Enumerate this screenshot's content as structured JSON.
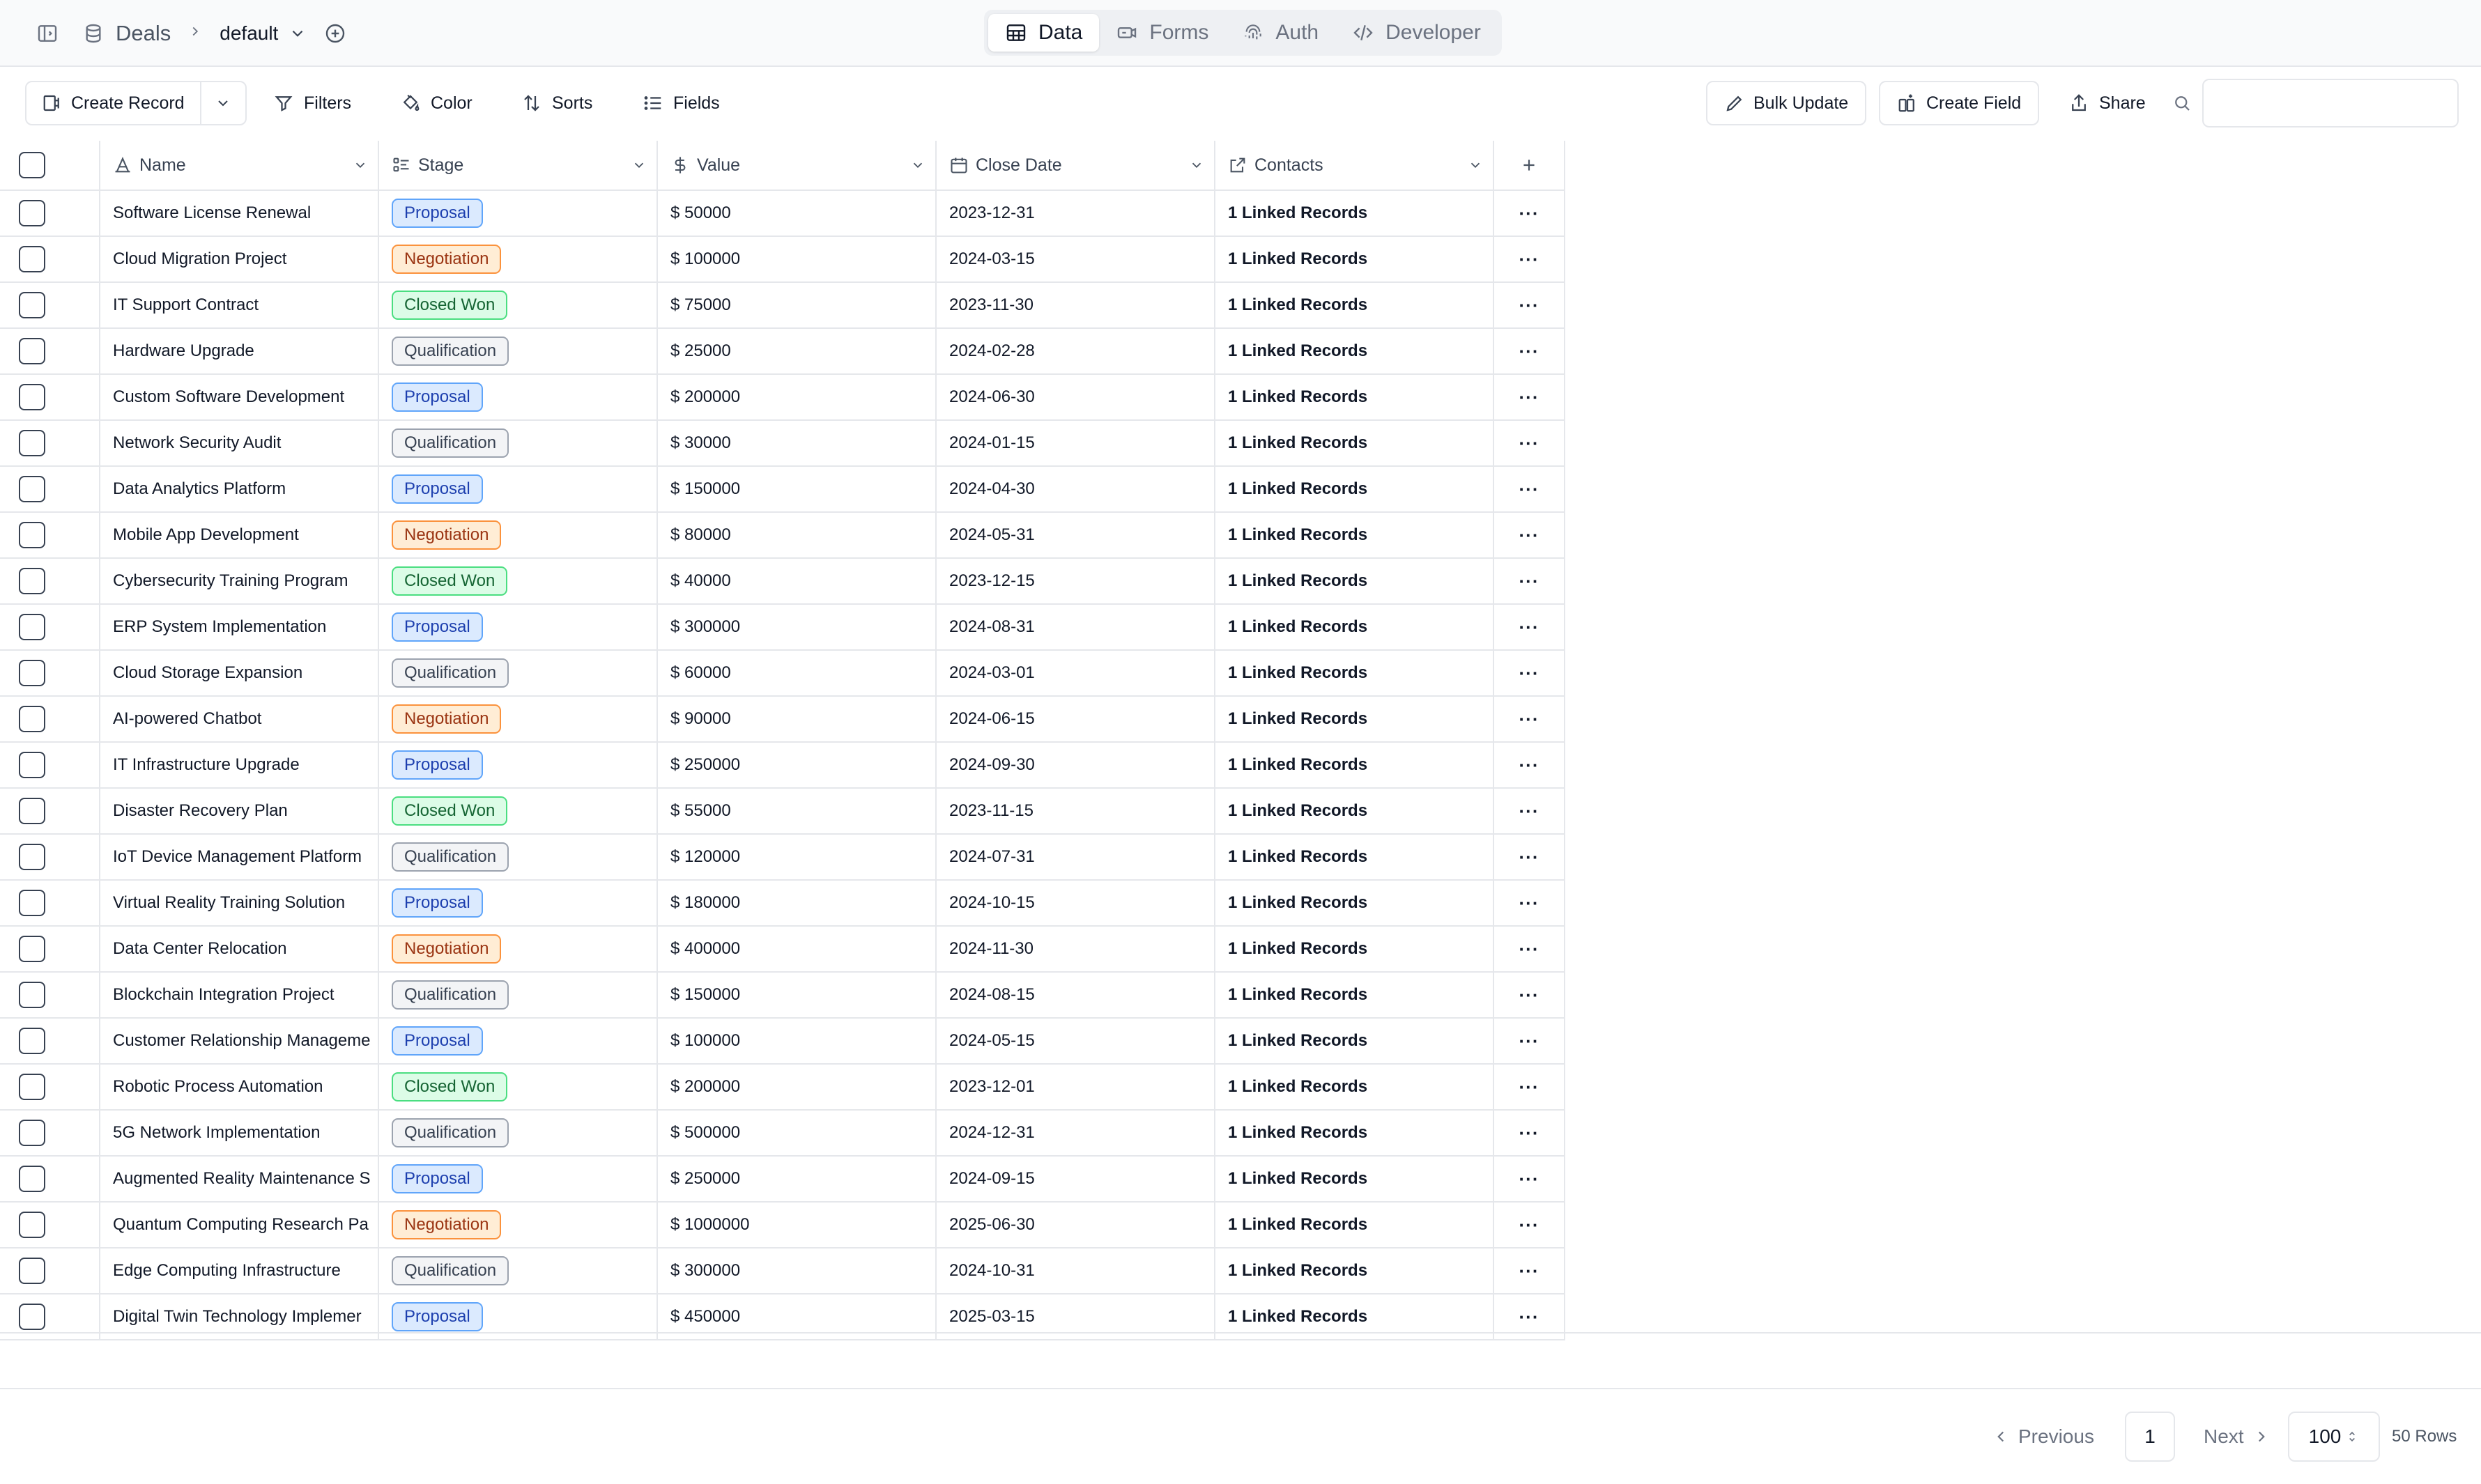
{
  "header": {
    "breadcrumb": {
      "table": "Deals",
      "view": "default"
    },
    "tabs": [
      {
        "label": "Data",
        "icon": "table-icon",
        "active": true
      },
      {
        "label": "Forms",
        "icon": "forms-icon",
        "active": false
      },
      {
        "label": "Auth",
        "icon": "fingerprint-icon",
        "active": false
      },
      {
        "label": "Developer",
        "icon": "code-icon",
        "active": false
      }
    ]
  },
  "toolbar": {
    "create_record": "Create Record",
    "filters": "Filters",
    "color": "Color",
    "sorts": "Sorts",
    "fields": "Fields",
    "bulk_update": "Bulk Update",
    "create_field": "Create Field",
    "share": "Share",
    "search_placeholder": ""
  },
  "table": {
    "columns": {
      "name": "Name",
      "stage": "Stage",
      "value": "Value",
      "close_date": "Close Date",
      "contacts": "Contacts"
    },
    "rows": [
      {
        "name": "Software License Renewal",
        "stage": "Proposal",
        "value": "$ 50000",
        "close_date": "2023-12-31",
        "contacts": "1 Linked Records"
      },
      {
        "name": "Cloud Migration Project",
        "stage": "Negotiation",
        "value": "$ 100000",
        "close_date": "2024-03-15",
        "contacts": "1 Linked Records"
      },
      {
        "name": "IT Support Contract",
        "stage": "Closed Won",
        "value": "$ 75000",
        "close_date": "2023-11-30",
        "contacts": "1 Linked Records"
      },
      {
        "name": "Hardware Upgrade",
        "stage": "Qualification",
        "value": "$ 25000",
        "close_date": "2024-02-28",
        "contacts": "1 Linked Records"
      },
      {
        "name": "Custom Software Development",
        "stage": "Proposal",
        "value": "$ 200000",
        "close_date": "2024-06-30",
        "contacts": "1 Linked Records"
      },
      {
        "name": "Network Security Audit",
        "stage": "Qualification",
        "value": "$ 30000",
        "close_date": "2024-01-15",
        "contacts": "1 Linked Records"
      },
      {
        "name": "Data Analytics Platform",
        "stage": "Proposal",
        "value": "$ 150000",
        "close_date": "2024-04-30",
        "contacts": "1 Linked Records"
      },
      {
        "name": "Mobile App Development",
        "stage": "Negotiation",
        "value": "$ 80000",
        "close_date": "2024-05-31",
        "contacts": "1 Linked Records"
      },
      {
        "name": "Cybersecurity Training Program",
        "stage": "Closed Won",
        "value": "$ 40000",
        "close_date": "2023-12-15",
        "contacts": "1 Linked Records"
      },
      {
        "name": "ERP System Implementation",
        "stage": "Proposal",
        "value": "$ 300000",
        "close_date": "2024-08-31",
        "contacts": "1 Linked Records"
      },
      {
        "name": "Cloud Storage Expansion",
        "stage": "Qualification",
        "value": "$ 60000",
        "close_date": "2024-03-01",
        "contacts": "1 Linked Records"
      },
      {
        "name": "AI-powered Chatbot",
        "stage": "Negotiation",
        "value": "$ 90000",
        "close_date": "2024-06-15",
        "contacts": "1 Linked Records"
      },
      {
        "name": "IT Infrastructure Upgrade",
        "stage": "Proposal",
        "value": "$ 250000",
        "close_date": "2024-09-30",
        "contacts": "1 Linked Records"
      },
      {
        "name": "Disaster Recovery Plan",
        "stage": "Closed Won",
        "value": "$ 55000",
        "close_date": "2023-11-15",
        "contacts": "1 Linked Records"
      },
      {
        "name": "IoT Device Management Platform",
        "stage": "Qualification",
        "value": "$ 120000",
        "close_date": "2024-07-31",
        "contacts": "1 Linked Records"
      },
      {
        "name": "Virtual Reality Training Solution",
        "stage": "Proposal",
        "value": "$ 180000",
        "close_date": "2024-10-15",
        "contacts": "1 Linked Records"
      },
      {
        "name": "Data Center Relocation",
        "stage": "Negotiation",
        "value": "$ 400000",
        "close_date": "2024-11-30",
        "contacts": "1 Linked Records"
      },
      {
        "name": "Blockchain Integration Project",
        "stage": "Qualification",
        "value": "$ 150000",
        "close_date": "2024-08-15",
        "contacts": "1 Linked Records"
      },
      {
        "name": "Customer Relationship Manageme",
        "stage": "Proposal",
        "value": "$ 100000",
        "close_date": "2024-05-15",
        "contacts": "1 Linked Records"
      },
      {
        "name": "Robotic Process Automation",
        "stage": "Closed Won",
        "value": "$ 200000",
        "close_date": "2023-12-01",
        "contacts": "1 Linked Records"
      },
      {
        "name": "5G Network Implementation",
        "stage": "Qualification",
        "value": "$ 500000",
        "close_date": "2024-12-31",
        "contacts": "1 Linked Records"
      },
      {
        "name": "Augmented Reality Maintenance S",
        "stage": "Proposal",
        "value": "$ 250000",
        "close_date": "2024-09-15",
        "contacts": "1 Linked Records"
      },
      {
        "name": "Quantum Computing Research Pa",
        "stage": "Negotiation",
        "value": "$ 1000000",
        "close_date": "2025-06-30",
        "contacts": "1 Linked Records"
      },
      {
        "name": "Edge Computing Infrastructure",
        "stage": "Qualification",
        "value": "$ 300000",
        "close_date": "2024-10-31",
        "contacts": "1 Linked Records"
      },
      {
        "name": "Digital Twin Technology Implemer",
        "stage": "Proposal",
        "value": "$ 450000",
        "close_date": "2025-03-15",
        "contacts": "1 Linked Records"
      }
    ]
  },
  "pagination": {
    "previous": "Previous",
    "page": "1",
    "next": "Next",
    "per_page": "100",
    "row_count": "50 Rows"
  },
  "stage_colors": {
    "Proposal": "#dbeafe",
    "Negotiation": "#ffedd5",
    "Closed Won": "#dcfce7",
    "Qualification": "#f3f4f6"
  }
}
